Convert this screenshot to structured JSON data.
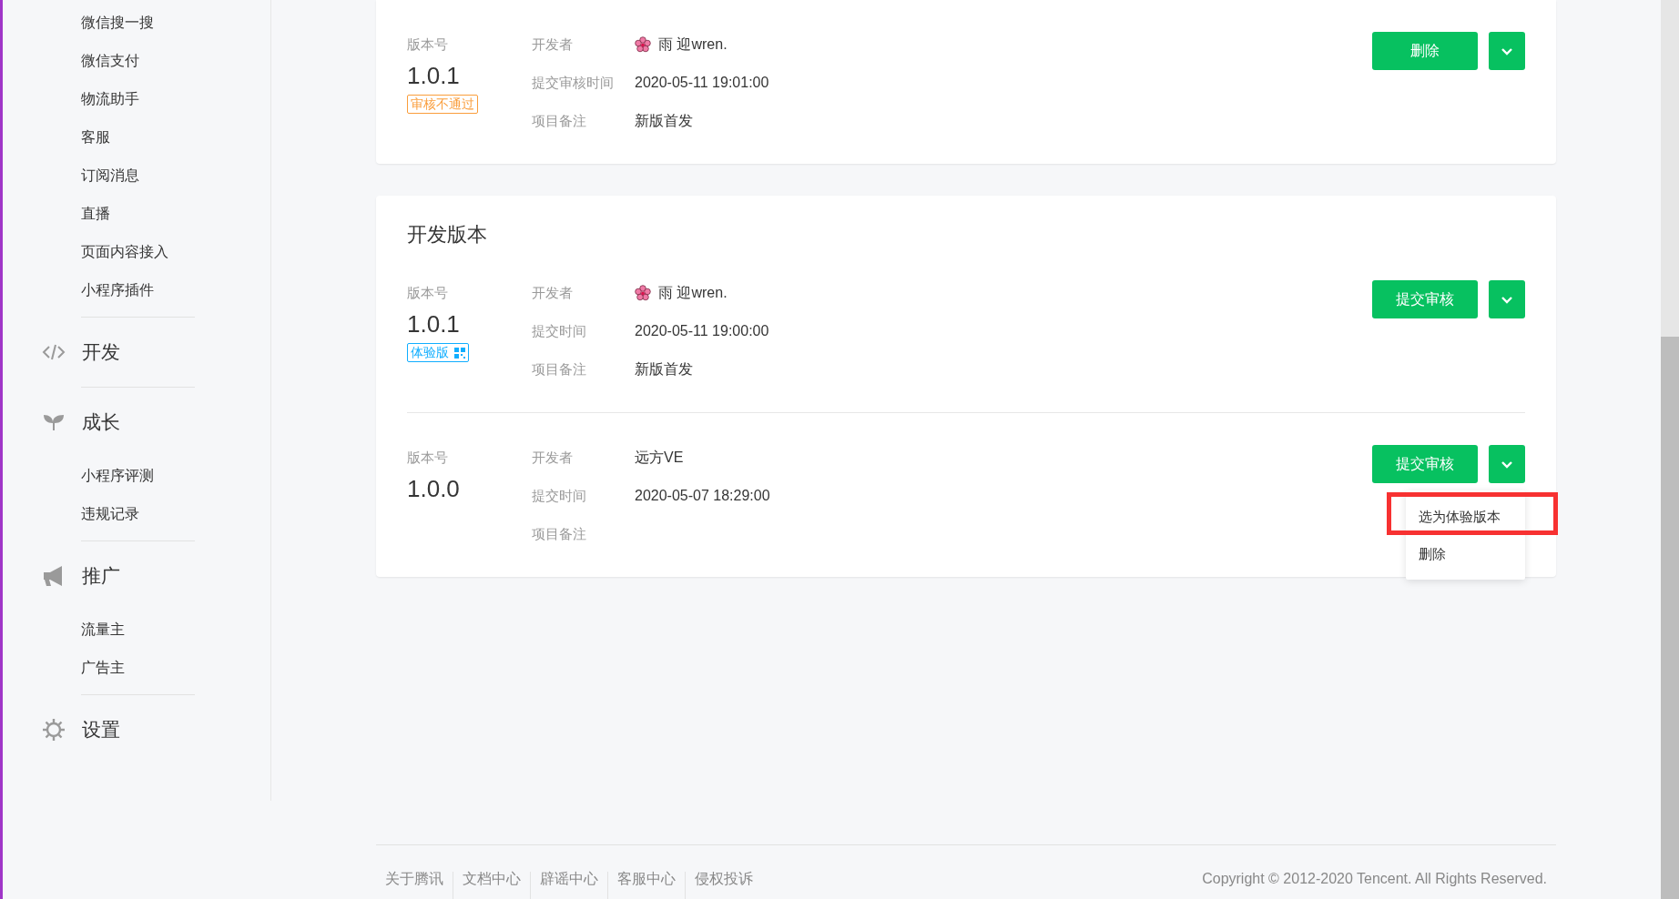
{
  "sidebar": {
    "groups": [
      {
        "items": [
          "微信搜一搜",
          "微信支付",
          "物流助手",
          "客服",
          "订阅消息",
          "直播",
          "页面内容接入",
          "小程序插件"
        ]
      },
      {
        "kind": "code",
        "title": "开发"
      },
      {
        "kind": "sprout",
        "title": "成长",
        "items": [
          "小程序评测",
          "违规记录"
        ]
      },
      {
        "kind": "megaphone",
        "title": "推广",
        "items": [
          "流量主",
          "广告主"
        ]
      },
      {
        "kind": "gear",
        "title": "设置"
      }
    ]
  },
  "cards": [
    {
      "entries": [
        {
          "version_label": "版本号",
          "version": "1.0.1",
          "tag": {
            "kind": "rejected",
            "text": "审核不通过"
          },
          "fields": [
            {
              "label": "开发者",
              "value": "雨 迎wren.",
              "avatar": true
            },
            {
              "label": "提交审核时间",
              "value": "2020-05-11 19:01:00"
            },
            {
              "label": "项目备注",
              "value": "新版首发"
            }
          ],
          "action": "删除"
        }
      ]
    },
    {
      "title": "开发版本",
      "entries": [
        {
          "version_label": "版本号",
          "version": "1.0.1",
          "tag": {
            "kind": "trial",
            "text": "体验版"
          },
          "fields": [
            {
              "label": "开发者",
              "value": "雨 迎wren.",
              "avatar": true
            },
            {
              "label": "提交时间",
              "value": "2020-05-11 19:00:00"
            },
            {
              "label": "项目备注",
              "value": "新版首发"
            }
          ],
          "action": "提交审核"
        },
        {
          "version_label": "版本号",
          "version": "1.0.0",
          "fields": [
            {
              "label": "开发者",
              "value": "远方VE",
              "avatar": false
            },
            {
              "label": "提交时间",
              "value": "2020-05-07 18:29:00"
            },
            {
              "label": "项目备注"
            }
          ],
          "action": "提交审核",
          "menu": [
            {
              "label": "选为体验版本",
              "highlighted": true
            },
            {
              "label": "删除",
              "highlighted": false
            }
          ]
        }
      ]
    }
  ],
  "footer": {
    "links": [
      "关于腾讯",
      "文档中心",
      "辟谣中心",
      "客服中心",
      "侵权投诉"
    ],
    "copyright": "Copyright © 2012-2020 Tencent. All Rights Reserved."
  }
}
